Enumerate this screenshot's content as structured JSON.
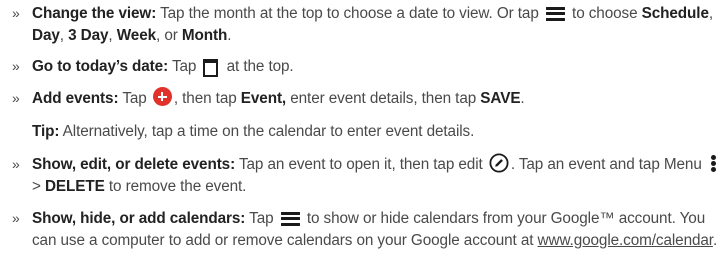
{
  "bullet_char": "»",
  "items": {
    "view": {
      "title": "Change the view:",
      "t1": " Tap the month at the top to choose a date to view. Or tap ",
      "t2": " to choose ",
      "opt1": "Schedule",
      "sep1": ", ",
      "opt2": "Day",
      "sep2": ", ",
      "opt3": "3 Day",
      "sep3": ", ",
      "opt4": "Week",
      "sep4": ", or ",
      "opt5": "Month",
      "end": "."
    },
    "today": {
      "title": "Go to today’s date:",
      "t1": " Tap ",
      "t2": " at the top."
    },
    "add": {
      "title": "Add events:",
      "t1": " Tap ",
      "t2": ", then tap ",
      "event": "Event,",
      "t3": " enter event details, then tap ",
      "save": "SAVE",
      "end": "."
    },
    "tip": {
      "label": "Tip:",
      "text": " Alternatively, tap a time on the calendar to enter event details."
    },
    "edit": {
      "title": "Show, edit, or delete events:",
      "t1": " Tap an event to open it, then tap edit ",
      "t2": ". Tap an event and tap Menu ",
      "t3": " > ",
      "delete": "DELETE",
      "t4": " to remove the event."
    },
    "calendars": {
      "title": "Show, hide, or add calendars:",
      "t1": " Tap ",
      "t2": " to show or hide calendars from your Google™ account. You can use a computer to add or remove calendars on your Google account at ",
      "link": "www.google.com/calendar",
      "end": "."
    }
  },
  "icons": {
    "menu": "menu-icon",
    "calendar": "calendar-icon",
    "add": "add-event-icon",
    "edit": "edit-icon",
    "more": "more-vertical-icon"
  },
  "colors": {
    "text": "#4a4a4a",
    "bold": "#222222",
    "icon": "#1a1a1a",
    "add_icon": "#e0322a"
  }
}
